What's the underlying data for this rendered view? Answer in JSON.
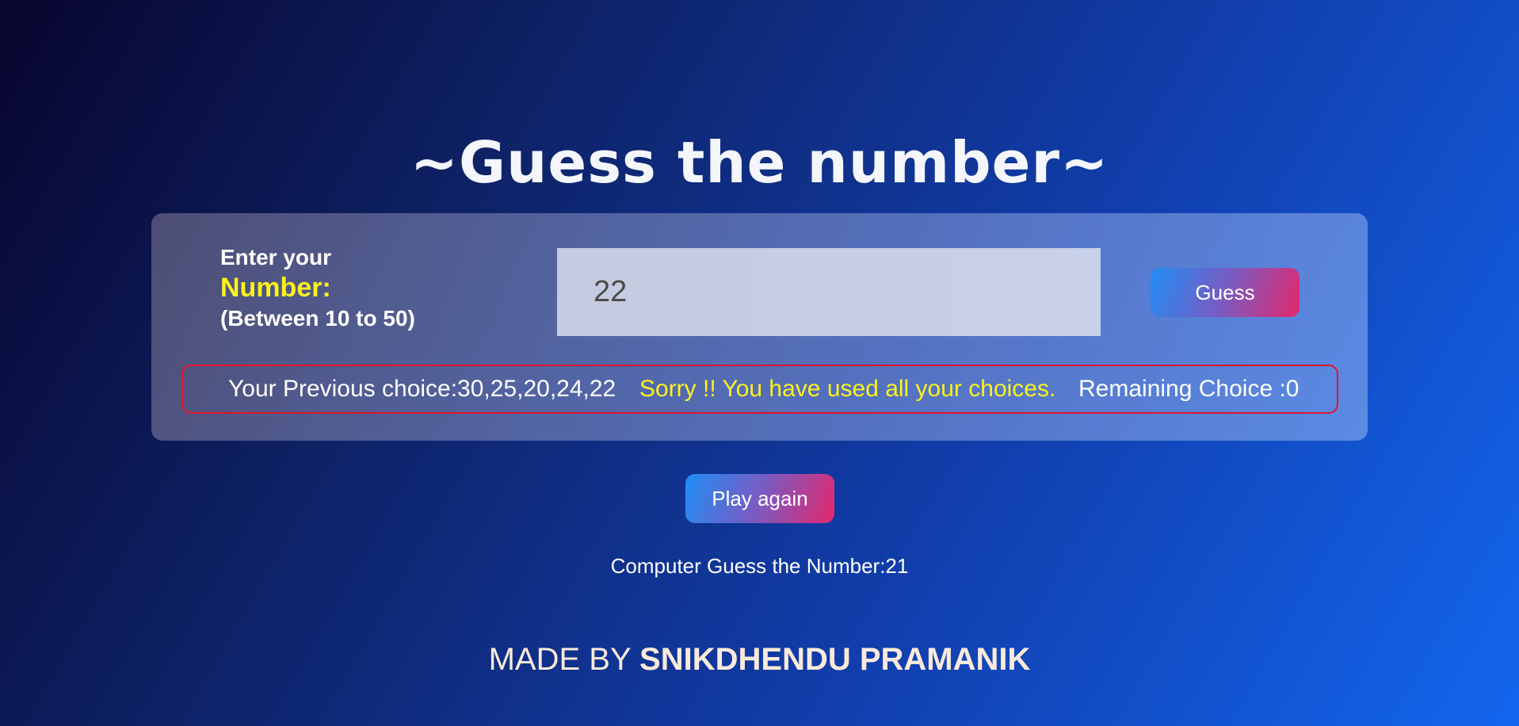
{
  "title": "~Guess the number~",
  "prompt": {
    "line1": "Enter your",
    "line2": "Number:",
    "line3": "(Between 10 to 50)"
  },
  "input": {
    "value": "22"
  },
  "buttons": {
    "guess": "Guess",
    "play_again": "Play again"
  },
  "status": {
    "previous_choice": "Your Previous choice:30,25,20,24,22",
    "message": "Sorry !! You have used all your choices.",
    "remaining": "Remaining Choice :0"
  },
  "computer_guess": "Computer Guess the Number:21",
  "footer": {
    "prefix": "MADE BY",
    "author": "SNIKDHENDU PRAMANIK"
  },
  "colors": {
    "accent_yellow": "#fdf21c",
    "error_border": "#e0152c",
    "button_gradient_start": "#1f8ef5",
    "button_gradient_end": "#e3286c"
  }
}
